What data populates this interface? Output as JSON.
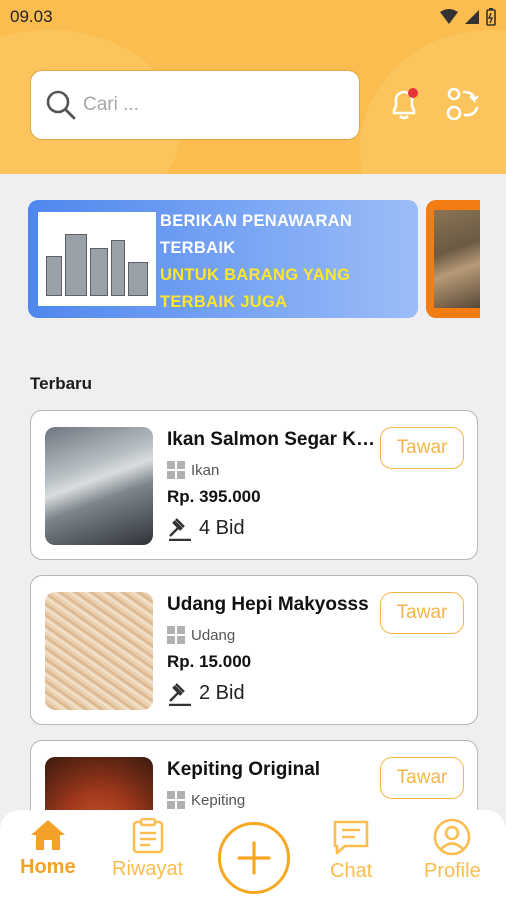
{
  "status_bar": {
    "time": "09.03"
  },
  "search": {
    "placeholder": "Cari ..."
  },
  "banner": {
    "line1": "BERIKAN PENAWARAN",
    "line2": "TERBAIK",
    "line3": "UNTUK BARANG YANG",
    "line4": "TERBAIK JUGA"
  },
  "section": {
    "title": "Terbaru"
  },
  "products": [
    {
      "title": "Ikan Salmon Segar Ku...",
      "category": "Ikan",
      "price": "Rp. 395.000",
      "bids": "4 Bid",
      "action": "Tawar"
    },
    {
      "title": "Udang Hepi Makyosss",
      "category": "Udang",
      "price": "Rp. 15.000",
      "bids": "2 Bid",
      "action": "Tawar"
    },
    {
      "title": "Kepiting Original",
      "category": "Kepiting",
      "price": "",
      "bids": "",
      "action": "Tawar"
    }
  ],
  "nav": {
    "home": "Home",
    "history": "Riwayat",
    "chat": "Chat",
    "profile": "Profile"
  },
  "colors": {
    "primary": "#fbbd4f",
    "accent": "#f3a128",
    "banner": "#4f87ee",
    "notification_dot": "#e5333a"
  }
}
